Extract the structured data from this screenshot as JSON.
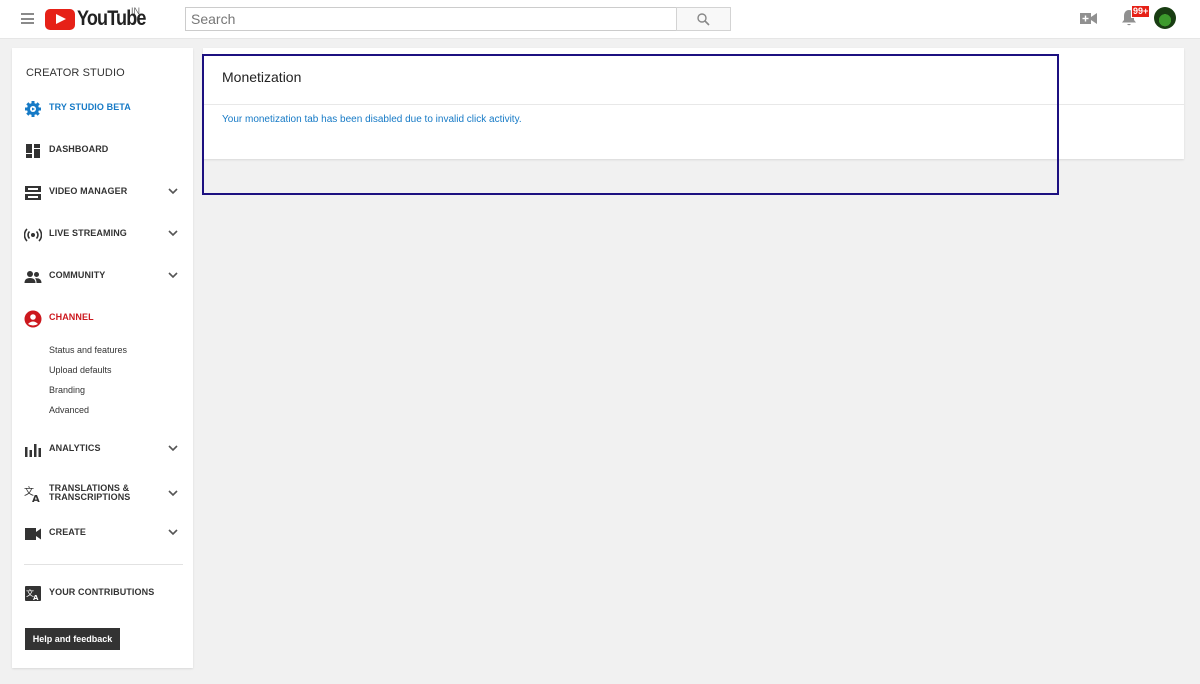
{
  "header": {
    "logo_text": "YouTube",
    "logo_country": "IN",
    "search_placeholder": "Search",
    "notification_count": "99+"
  },
  "sidebar": {
    "title": "CREATOR STUDIO",
    "items": [
      {
        "label": "TRY STUDIO BETA",
        "icon": "gear-icon",
        "color": "#167ac6"
      },
      {
        "label": "DASHBOARD",
        "icon": "dashboard-icon"
      },
      {
        "label": "VIDEO MANAGER",
        "icon": "video-manager-icon",
        "expandable": true
      },
      {
        "label": "LIVE STREAMING",
        "icon": "live-streaming-icon",
        "expandable": true
      },
      {
        "label": "COMMUNITY",
        "icon": "community-icon",
        "expandable": true
      },
      {
        "label": "CHANNEL",
        "icon": "channel-icon",
        "color": "#cc181e"
      },
      {
        "label": "ANALYTICS",
        "icon": "analytics-icon",
        "expandable": true
      },
      {
        "label": "TRANSLATIONS &",
        "label2": "TRANSCRIPTIONS",
        "icon": "translate-icon",
        "expandable": true
      },
      {
        "label": "CREATE",
        "icon": "create-video-icon",
        "expandable": true
      },
      {
        "label": "YOUR CONTRIBUTIONS",
        "icon": "contributions-icon"
      }
    ],
    "channel_subitems": [
      "Status and features",
      "Upload defaults",
      "Branding",
      "Advanced"
    ],
    "help_button": "Help and feedback"
  },
  "main": {
    "title": "Monetization",
    "message": "Your monetization tab has been disabled due to invalid click activity.",
    "message_color": "#167ac6",
    "highlight_color": "#1c1080"
  }
}
